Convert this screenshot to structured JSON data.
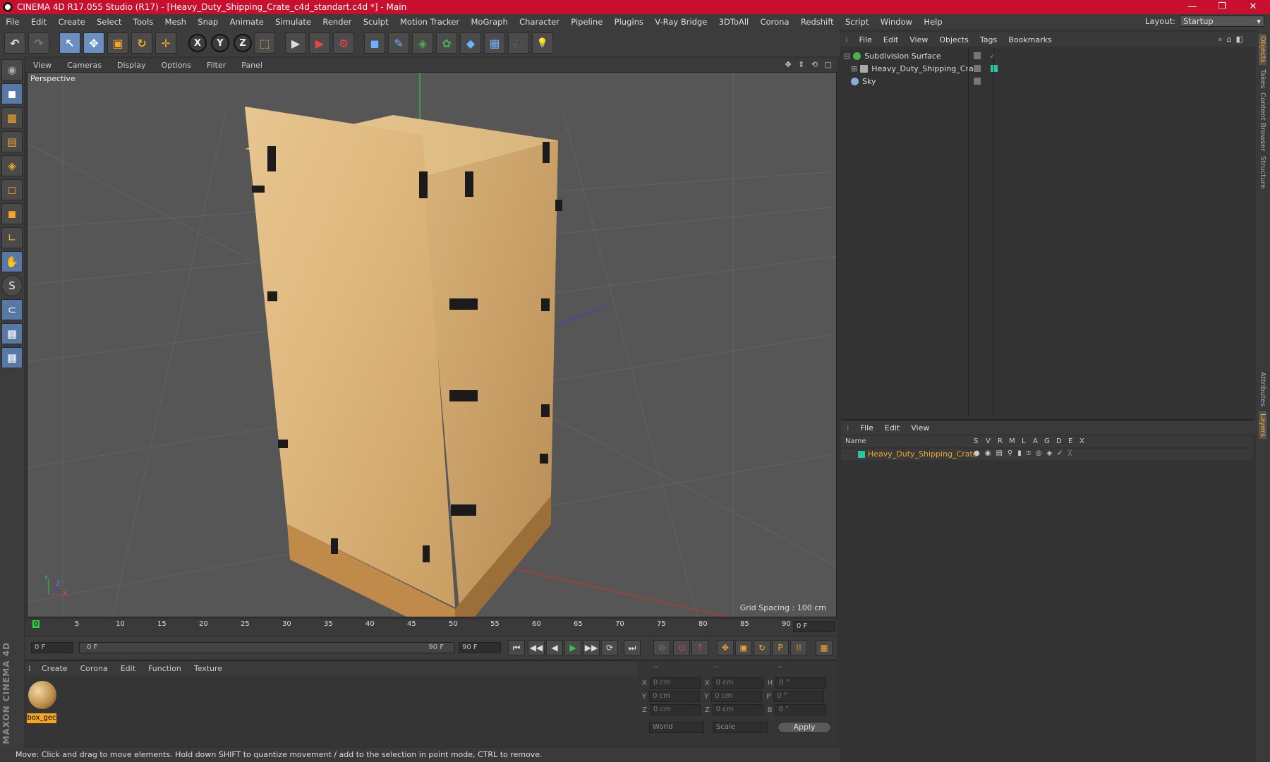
{
  "window": {
    "title": "CINEMA 4D R17.055 Studio (R17) - [Heavy_Duty_Shipping_Crate_c4d_standart.c4d *] - Main",
    "minimize": "—",
    "maximize": "❐",
    "close": "✕"
  },
  "menubar": {
    "items": [
      "File",
      "Edit",
      "Create",
      "Select",
      "Tools",
      "Mesh",
      "Snap",
      "Animate",
      "Simulate",
      "Render",
      "Sculpt",
      "Motion Tracker",
      "MoGraph",
      "Character",
      "Pipeline",
      "Plugins",
      "V-Ray Bridge",
      "3DToAll",
      "Corona",
      "Redshift",
      "Script",
      "Window",
      "Help"
    ],
    "layout_label": "Layout:",
    "layout_value": "Startup"
  },
  "toolbar": {
    "undo": "↶",
    "redo": "↷",
    "select": "↖",
    "move": "✥",
    "scale": "▣",
    "rotate": "↻",
    "transform": "✛",
    "x": "X",
    "y": "Y",
    "z": "Z",
    "coord": "⬚",
    "render_view": "▶",
    "render_pic": "▶",
    "render_settings": "⚙",
    "cube": "◼",
    "pen": "✎",
    "subdiv": "◈",
    "cloner": "✿",
    "deformer": "◆",
    "floor": "▦",
    "camera": "🎥",
    "light": "💡"
  },
  "lefttools": {
    "items": [
      "◉",
      "◼",
      "▩",
      "▤",
      "◈",
      "◻",
      "◼",
      "∟",
      "✋",
      "S",
      "⊂",
      "▦",
      "▦"
    ]
  },
  "viewport": {
    "menu": [
      "View",
      "Cameras",
      "Display",
      "Options",
      "Filter",
      "Panel"
    ],
    "nav_icons": "✥ ⇕ ⟲ ▢",
    "label": "Perspective",
    "grid_spacing": "Grid Spacing : 100 cm",
    "axis_y": "Y",
    "axis_z": "Z",
    "axis_x": "X"
  },
  "timeline": {
    "ticks": [
      "0",
      "5",
      "10",
      "15",
      "20",
      "25",
      "30",
      "35",
      "40",
      "45",
      "50",
      "55",
      "60",
      "65",
      "70",
      "75",
      "80",
      "85",
      "90"
    ],
    "current_frame": "0 F"
  },
  "playback": {
    "start_field": "0 F",
    "range_start": "0 F",
    "range_end": "90 F",
    "end_field": "90 F",
    "buttons": [
      "⏮",
      "◀◀",
      "◀",
      "▶",
      "▶▶",
      "⟳",
      "⏭"
    ],
    "key_buttons": [
      "⊘",
      "⊙",
      "?",
      "✥",
      "▣",
      "↻",
      "P",
      "⁞⁞",
      "▦"
    ]
  },
  "material": {
    "menu": [
      "Create",
      "Corona",
      "Edit",
      "Function",
      "Texture"
    ],
    "items": [
      {
        "name": "box_gec"
      }
    ]
  },
  "coordinates": {
    "header": [
      "--",
      "--",
      "--"
    ],
    "rows": [
      {
        "a": "X",
        "av": "0 cm",
        "b": "X",
        "bv": "0 cm",
        "c": "H",
        "cv": "0 °"
      },
      {
        "a": "Y",
        "av": "0 cm",
        "b": "Y",
        "bv": "0 cm",
        "c": "P",
        "cv": "0 °"
      },
      {
        "a": "Z",
        "av": "0 cm",
        "b": "Z",
        "bv": "0 cm",
        "c": "B",
        "cv": "0 °"
      }
    ],
    "mode": "World",
    "scale": "Scale",
    "apply": "Apply"
  },
  "status": "Move: Click and drag to move elements. Hold down SHIFT to quantize movement / add to the selection in point mode, CTRL to remove.",
  "objects": {
    "menu": [
      "File",
      "Edit",
      "View",
      "Objects",
      "Tags",
      "Bookmarks"
    ],
    "items": [
      {
        "name": "Subdivision Surface",
        "color": "#4caf50"
      },
      {
        "name": "Heavy_Duty_Shipping_Crate",
        "color": "#aaaaaa"
      },
      {
        "name": "Sky",
        "color": "#88aadd"
      }
    ]
  },
  "layers": {
    "menu": [
      "File",
      "Edit",
      "View"
    ],
    "columns": [
      "Name",
      "S",
      "V",
      "R",
      "M",
      "L",
      "A",
      "G",
      "D",
      "E",
      "X"
    ],
    "items": [
      {
        "name": "Heavy_Duty_Shipping_Crate",
        "color": "#26c6a0"
      }
    ]
  },
  "sidetabs": [
    "Objects",
    "Takes",
    "Content Browser",
    "Structure",
    "Attributes",
    "Layers"
  ],
  "brand": "MAXON CINEMA 4D",
  "colors": {
    "accent": "#f5a623",
    "title_red": "#c8102e",
    "layer_green": "#26c6a0"
  }
}
